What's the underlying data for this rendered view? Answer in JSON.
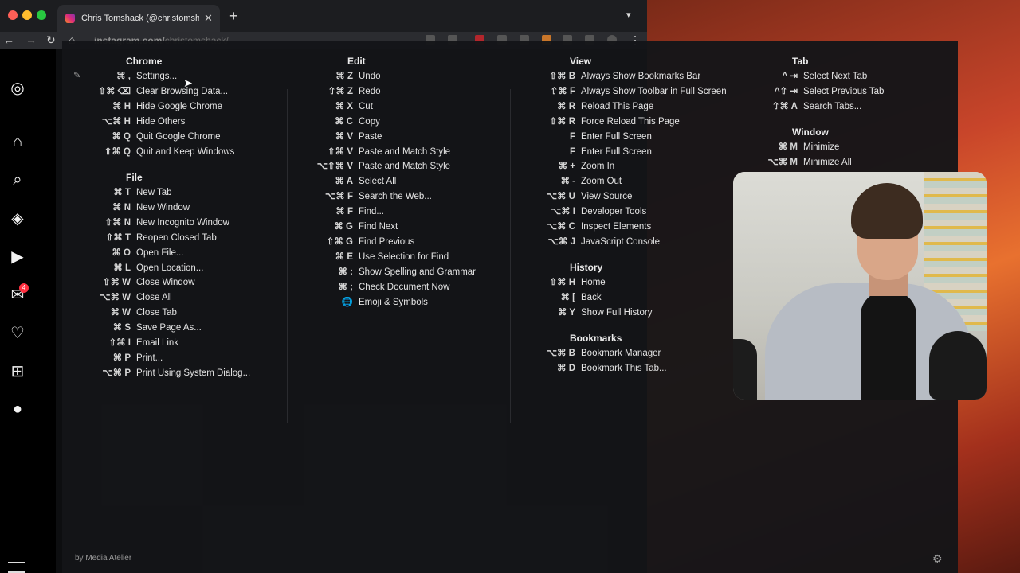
{
  "browser": {
    "tab_title": "Chris Tomshack (@christomshack)",
    "new_tab": "+",
    "url_host": "instagram.com/",
    "url_path": "christomshack/"
  },
  "sidebar": {
    "notification_count": "4"
  },
  "sections": {
    "chrome": {
      "title": "Chrome",
      "items": [
        {
          "keys": "⌘ ,",
          "label": "Settings..."
        },
        {
          "keys": "⇧⌘ ⌫",
          "label": "Clear Browsing Data..."
        },
        {
          "keys": "⌘ H",
          "label": "Hide Google Chrome"
        },
        {
          "keys": "⌥⌘ H",
          "label": "Hide Others"
        },
        {
          "keys": "⌘ Q",
          "label": "Quit Google Chrome"
        },
        {
          "keys": "⇧⌘ Q",
          "label": "Quit and Keep Windows"
        }
      ]
    },
    "file": {
      "title": "File",
      "items": [
        {
          "keys": "⌘ T",
          "label": "New Tab"
        },
        {
          "keys": "⌘ N",
          "label": "New Window"
        },
        {
          "keys": "⇧⌘ N",
          "label": "New Incognito Window"
        },
        {
          "keys": "⇧⌘ T",
          "label": "Reopen Closed Tab"
        },
        {
          "keys": "⌘ O",
          "label": "Open File..."
        },
        {
          "keys": "⌘ L",
          "label": "Open Location..."
        },
        {
          "keys": "⇧⌘ W",
          "label": "Close Window"
        },
        {
          "keys": "⌥⌘ W",
          "label": "Close All"
        },
        {
          "keys": "⌘ W",
          "label": "Close Tab"
        },
        {
          "keys": "⌘ S",
          "label": "Save Page As..."
        },
        {
          "keys": "⇧⌘ I",
          "label": "Email Link"
        },
        {
          "keys": "⌘ P",
          "label": "Print..."
        },
        {
          "keys": "⌥⌘ P",
          "label": "Print Using System Dialog..."
        }
      ]
    },
    "edit": {
      "title": "Edit",
      "items": [
        {
          "keys": "⌘ Z",
          "label": "Undo"
        },
        {
          "keys": "⇧⌘ Z",
          "label": "Redo"
        },
        {
          "keys": "⌘ X",
          "label": "Cut"
        },
        {
          "keys": "⌘ C",
          "label": "Copy"
        },
        {
          "keys": "⌘ V",
          "label": "Paste"
        },
        {
          "keys": "⇧⌘ V",
          "label": "Paste and Match Style"
        },
        {
          "keys": "⌥⇧⌘ V",
          "label": "Paste and Match Style"
        },
        {
          "keys": "⌘ A",
          "label": "Select All"
        },
        {
          "keys": "⌥⌘ F",
          "label": "Search the Web..."
        },
        {
          "keys": "⌘ F",
          "label": "Find..."
        },
        {
          "keys": "⌘ G",
          "label": "Find Next"
        },
        {
          "keys": "⇧⌘ G",
          "label": "Find Previous"
        },
        {
          "keys": "⌘ E",
          "label": "Use Selection for Find"
        },
        {
          "keys": "⌘ :",
          "label": "Show Spelling and Grammar"
        },
        {
          "keys": "⌘ ;",
          "label": "Check Document Now"
        },
        {
          "keys": "🌐",
          "label": "Emoji & Symbols"
        }
      ]
    },
    "view": {
      "title": "View",
      "items": [
        {
          "keys": "⇧⌘ B",
          "label": "Always Show Bookmarks Bar"
        },
        {
          "keys": "⇧⌘ F",
          "label": "Always Show Toolbar in Full Screen"
        },
        {
          "keys": "⌘ R",
          "label": "Reload This Page"
        },
        {
          "keys": "⇧⌘ R",
          "label": "Force Reload This Page"
        },
        {
          "keys": "F",
          "label": "Enter Full Screen"
        },
        {
          "keys": "F",
          "label": "Enter Full Screen"
        },
        {
          "keys": "⌘ +",
          "label": "Zoom In"
        },
        {
          "keys": "⌘ -",
          "label": "Zoom Out"
        },
        {
          "keys": "⌥⌘ U",
          "label": "View Source"
        },
        {
          "keys": "⌥⌘ I",
          "label": "Developer Tools"
        },
        {
          "keys": "⌥⌘ C",
          "label": "Inspect Elements"
        },
        {
          "keys": "⌥⌘ J",
          "label": "JavaScript Console"
        }
      ]
    },
    "history": {
      "title": "History",
      "items": [
        {
          "keys": "⇧⌘ H",
          "label": "Home"
        },
        {
          "keys": "⌘ [",
          "label": "Back"
        },
        {
          "keys": "⌘ Y",
          "label": "Show Full History"
        }
      ]
    },
    "bookmarks": {
      "title": "Bookmarks",
      "items": [
        {
          "keys": "⌥⌘ B",
          "label": "Bookmark Manager"
        },
        {
          "keys": "⌘ D",
          "label": "Bookmark This Tab..."
        }
      ]
    },
    "tab": {
      "title": "Tab",
      "items": [
        {
          "keys": "^ ⇥",
          "label": "Select Next Tab"
        },
        {
          "keys": "^⇧ ⇥",
          "label": "Select Previous Tab"
        },
        {
          "keys": "⇧⌘ A",
          "label": "Search Tabs..."
        }
      ]
    },
    "window": {
      "title": "Window",
      "items": [
        {
          "keys": "⌘ M",
          "label": "Minimize"
        },
        {
          "keys": "⌥⌘ M",
          "label": "Minimize All"
        }
      ]
    }
  },
  "footer": {
    "credit": "by Media Atelier"
  }
}
